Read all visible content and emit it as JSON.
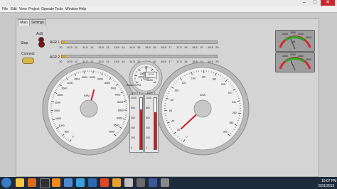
{
  "window": {
    "title": "",
    "controls": {
      "minimize": "–",
      "maximize": "□",
      "close": "✕"
    }
  },
  "menu": [
    "File",
    "Edit",
    "View",
    "Project",
    "Operate",
    "Tools",
    "Window",
    "Help"
  ],
  "tabs": [
    "Main",
    "Settings"
  ],
  "controls": {
    "afr_label": "AcB",
    "stop_label": "Stop",
    "connect_label": "Connect",
    "afr1_label": "AFR 1",
    "afr2_label": "AFR 2",
    "afr_scale": [
      "10",
      "10.5",
      "11",
      "11.5",
      "12",
      "12.5",
      "13",
      "13.5",
      "14",
      "14.5",
      "15",
      "15.5",
      "16",
      "16.5",
      "17",
      "17.5",
      "18",
      "18.5",
      "19",
      "19.5",
      "20"
    ]
  },
  "rpm_gauge": {
    "unit": "RPM",
    "ticks": [
      "0",
      "500",
      "1000",
      "1500",
      "2000",
      "2500",
      "3000",
      "3500",
      "4000",
      "4500",
      "5000",
      "5500",
      "6000",
      "6500",
      "7000",
      "7500",
      "8000",
      "8500",
      "9000",
      "9500",
      "9999"
    ],
    "value": 5800,
    "max": 9999
  },
  "boost_gauge": {
    "label": "Brake\nRPM",
    "ticks": [
      "0",
      "1000",
      "2000",
      "3000",
      "4000",
      "5000",
      "6000"
    ],
    "display": "3000"
  },
  "egt": {
    "egt1_label": "EGT 1",
    "egt2_label": "EGT 2",
    "ticks": [
      "1000",
      "800",
      "600",
      "400",
      "200",
      "0"
    ],
    "egt1_fraction": 0.78,
    "egt2_fraction": 0.72
  },
  "speed_gauge": {
    "unit": "Km/h",
    "ticks": [
      "0",
      "20",
      "40",
      "60",
      "80",
      "100",
      "120",
      "140",
      "160",
      "180",
      "200",
      "220",
      "240",
      "260",
      "280",
      "300"
    ],
    "value": 18,
    "max": 300
  },
  "afr_meter": {
    "ticks": [
      "1000",
      "2000",
      "3000",
      "4000"
    ],
    "label": "Afr"
  },
  "oil_meter": {
    "ticks": [
      "1000",
      "2000",
      "3000",
      "4000"
    ]
  },
  "taskbar": {
    "time": "10:07 PM",
    "date": "8/31/2015"
  },
  "colors": {
    "needle": "#d21b1b",
    "tank_fill": "#c41e1e",
    "slider_fill": "#e0a800",
    "taskbar": "#1e2b3b"
  }
}
